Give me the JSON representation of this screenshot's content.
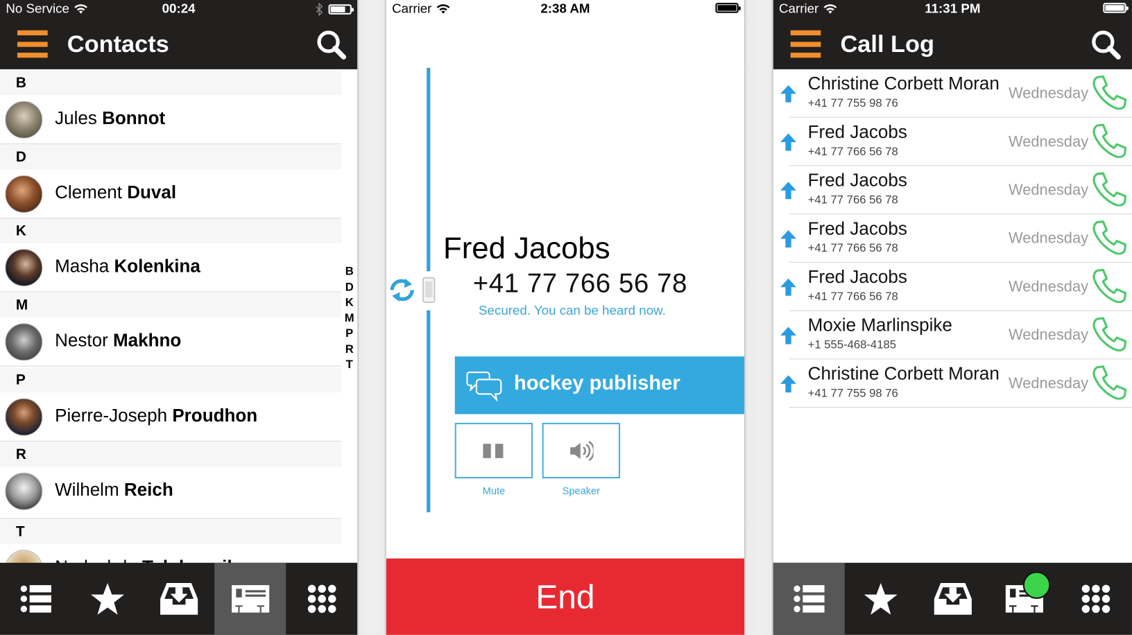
{
  "contacts_screen": {
    "status": {
      "carrier": "No Service",
      "time": "00:24",
      "battery_level": 0.7
    },
    "title": "Contacts",
    "sections": [
      {
        "letter": "B",
        "contacts": [
          {
            "first": "Jules",
            "last": "Bonnot"
          }
        ]
      },
      {
        "letter": "D",
        "contacts": [
          {
            "first": "Clement",
            "last": "Duval"
          }
        ]
      },
      {
        "letter": "K",
        "contacts": [
          {
            "first": "Masha",
            "last": "Kolenkina"
          }
        ]
      },
      {
        "letter": "M",
        "contacts": [
          {
            "first": "Nestor",
            "last": "Makhno"
          }
        ]
      },
      {
        "letter": "P",
        "contacts": [
          {
            "first": "Pierre-Joseph",
            "last": "Proudhon"
          }
        ]
      },
      {
        "letter": "R",
        "contacts": [
          {
            "first": "Wilhelm",
            "last": "Reich"
          }
        ]
      },
      {
        "letter": "T",
        "contacts": [
          {
            "first": "Nadezhda",
            "last": "Tolokonnikova"
          }
        ]
      }
    ],
    "index_letters": [
      "B",
      "D",
      "K",
      "M",
      "P",
      "R",
      "T"
    ],
    "tabs": [
      {
        "icon": "list-icon",
        "active": false
      },
      {
        "icon": "star-icon",
        "active": false
      },
      {
        "icon": "inbox-icon",
        "active": false
      },
      {
        "icon": "contact-card-icon",
        "active": true
      },
      {
        "icon": "keypad-icon",
        "active": false
      }
    ]
  },
  "call_screen": {
    "status": {
      "carrier": "Carrier",
      "time": "2:38 AM",
      "battery_level": 1.0
    },
    "caller_name": "Fred Jacobs",
    "caller_number": "+41 77 766 56 78",
    "security_status": "Secured. You can be heard now.",
    "sas_phrase": "hockey publisher",
    "mute_label": "Mute",
    "speaker_label": "Speaker",
    "end_label": "End",
    "colors": {
      "accent": "#34a9df",
      "end": "#e72a32"
    }
  },
  "calllog_screen": {
    "status": {
      "carrier": "Carrier",
      "time": "11:31 PM",
      "battery_level": 1.0
    },
    "title": "Call Log",
    "entries": [
      {
        "name": "Christine Corbett Moran",
        "number": "+41 77 755 98 76",
        "day": "Wednesday",
        "direction": "outgoing"
      },
      {
        "name": "Fred Jacobs",
        "number": "+41 77 766 56 78",
        "day": "Wednesday",
        "direction": "outgoing"
      },
      {
        "name": "Fred Jacobs",
        "number": "+41 77 766 56 78",
        "day": "Wednesday",
        "direction": "outgoing"
      },
      {
        "name": "Fred Jacobs",
        "number": "+41 77 766 56 78",
        "day": "Wednesday",
        "direction": "outgoing"
      },
      {
        "name": "Fred Jacobs",
        "number": "+41 77 766 56 78",
        "day": "Wednesday",
        "direction": "outgoing"
      },
      {
        "name": "Moxie Marlinspike",
        "number": "+1 555-468-4185",
        "day": "Wednesday",
        "direction": "outgoing"
      },
      {
        "name": "Christine Corbett Moran",
        "number": "+41 77 755 98 76",
        "day": "Wednesday",
        "direction": "outgoing"
      }
    ],
    "tabs": [
      {
        "icon": "list-icon",
        "active": true
      },
      {
        "icon": "star-icon",
        "active": false
      },
      {
        "icon": "inbox-icon",
        "active": false
      },
      {
        "icon": "contact-card-icon",
        "active": false,
        "badge": true
      },
      {
        "icon": "keypad-icon",
        "active": false
      }
    ],
    "colors": {
      "outgoing_arrow": "#2a9be0",
      "call_icon": "#4cc96a",
      "badge": "#3cd44a"
    }
  }
}
